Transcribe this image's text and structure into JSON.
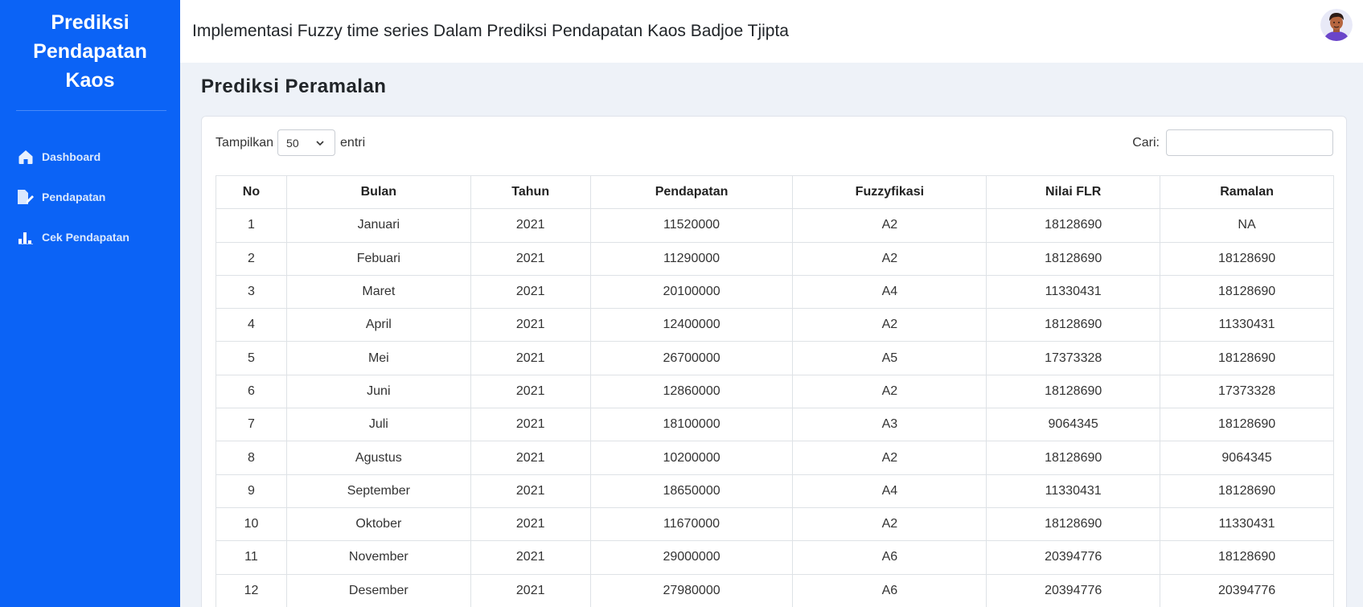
{
  "sidebar": {
    "brand": [
      "Prediksi",
      "Pendapatan",
      "Kaos"
    ],
    "items": [
      {
        "label": "Dashboard",
        "icon": "home-icon"
      },
      {
        "label": "Pendapatan",
        "icon": "edit-file-icon"
      },
      {
        "label": "Cek Pendapatan",
        "icon": "bar-chart-icon"
      }
    ]
  },
  "header": {
    "title": "Implementasi Fuzzy time series Dalam Prediksi Pendapatan Kaos Badjoe Tjipta"
  },
  "page": {
    "title": "Prediksi Peramalan"
  },
  "table_controls": {
    "show_label": "Tampilkan",
    "show_value": "50",
    "entries_label": "entri",
    "search_label": "Cari:",
    "search_value": ""
  },
  "table": {
    "columns": [
      "No",
      "Bulan",
      "Tahun",
      "Pendapatan",
      "Fuzzyfikasi",
      "Nilai FLR",
      "Ramalan"
    ],
    "rows": [
      [
        "1",
        "Januari",
        "2021",
        "11520000",
        "A2",
        "18128690",
        "NA"
      ],
      [
        "2",
        "Febuari",
        "2021",
        "11290000",
        "A2",
        "18128690",
        "18128690"
      ],
      [
        "3",
        "Maret",
        "2021",
        "20100000",
        "A4",
        "11330431",
        "18128690"
      ],
      [
        "4",
        "April",
        "2021",
        "12400000",
        "A2",
        "18128690",
        "11330431"
      ],
      [
        "5",
        "Mei",
        "2021",
        "26700000",
        "A5",
        "17373328",
        "18128690"
      ],
      [
        "6",
        "Juni",
        "2021",
        "12860000",
        "A2",
        "18128690",
        "17373328"
      ],
      [
        "7",
        "Juli",
        "2021",
        "18100000",
        "A3",
        "9064345",
        "18128690"
      ],
      [
        "8",
        "Agustus",
        "2021",
        "10200000",
        "A2",
        "18128690",
        "9064345"
      ],
      [
        "9",
        "September",
        "2021",
        "18650000",
        "A4",
        "11330431",
        "18128690"
      ],
      [
        "10",
        "Oktober",
        "2021",
        "11670000",
        "A2",
        "18128690",
        "11330431"
      ],
      [
        "11",
        "November",
        "2021",
        "29000000",
        "A6",
        "20394776",
        "18128690"
      ],
      [
        "12",
        "Desember",
        "2021",
        "27980000",
        "A6",
        "20394776",
        "20394776"
      ]
    ]
  }
}
